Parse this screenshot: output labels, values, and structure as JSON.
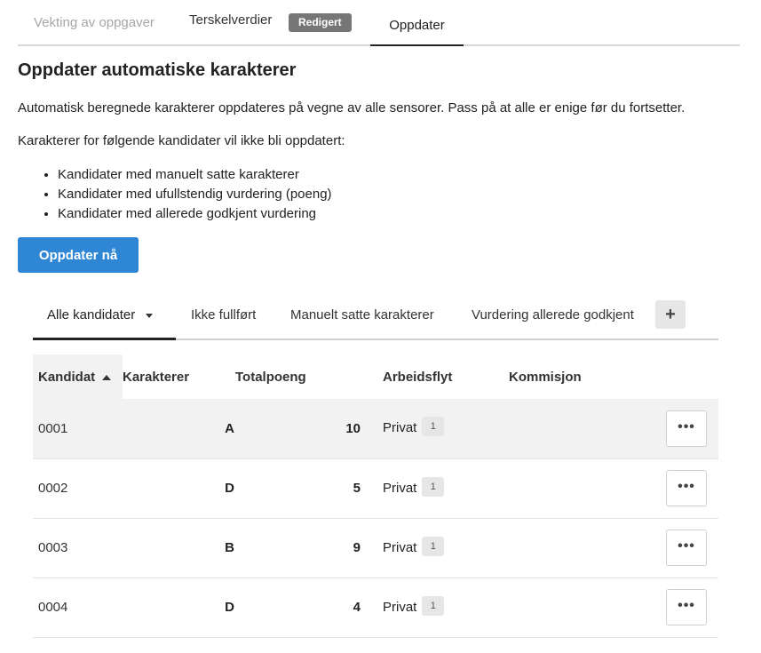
{
  "top_tabs": {
    "weighting": "Vekting av oppgaver",
    "thresholds": "Terskelverdier",
    "edited_badge": "Redigert",
    "update": "Oppdater"
  },
  "page": {
    "title": "Oppdater automatiske karakterer",
    "intro": "Automatisk beregnede karakterer oppdateres på vegne av alle sensorer. Pass på at alle er enige før du fortsetter.",
    "exclusion_intro": "Karakterer for følgende kandidater vil ikke bli oppdatert:",
    "exclusions": [
      "Kandidater med manuelt satte karakterer",
      "Kandidater med ufullstendig vurdering (poeng)",
      "Kandidater med allerede godkjent vurdering"
    ],
    "update_button": "Oppdater nå"
  },
  "filter_tabs": {
    "all": "Alle kandidater",
    "incomplete": "Ikke fullført",
    "manual": "Manuelt satte karakterer",
    "approved": "Vurdering allerede godkjent",
    "add_label": "+"
  },
  "table": {
    "headers": {
      "candidate": "Kandidat",
      "grades": "Karakterer",
      "total_points": "Totalpoeng",
      "workflow": "Arbeidsflyt",
      "commission": "Kommisjon"
    },
    "rows": [
      {
        "candidate": "0001",
        "grade": "A",
        "points": "10",
        "workflow": "Privat",
        "count": "1",
        "more": "•••"
      },
      {
        "candidate": "0002",
        "grade": "D",
        "points": "5",
        "workflow": "Privat",
        "count": "1",
        "more": "•••"
      },
      {
        "candidate": "0003",
        "grade": "B",
        "points": "9",
        "workflow": "Privat",
        "count": "1",
        "more": "•••"
      },
      {
        "candidate": "0004",
        "grade": "D",
        "points": "4",
        "workflow": "Privat",
        "count": "1",
        "more": "•••"
      }
    ]
  }
}
